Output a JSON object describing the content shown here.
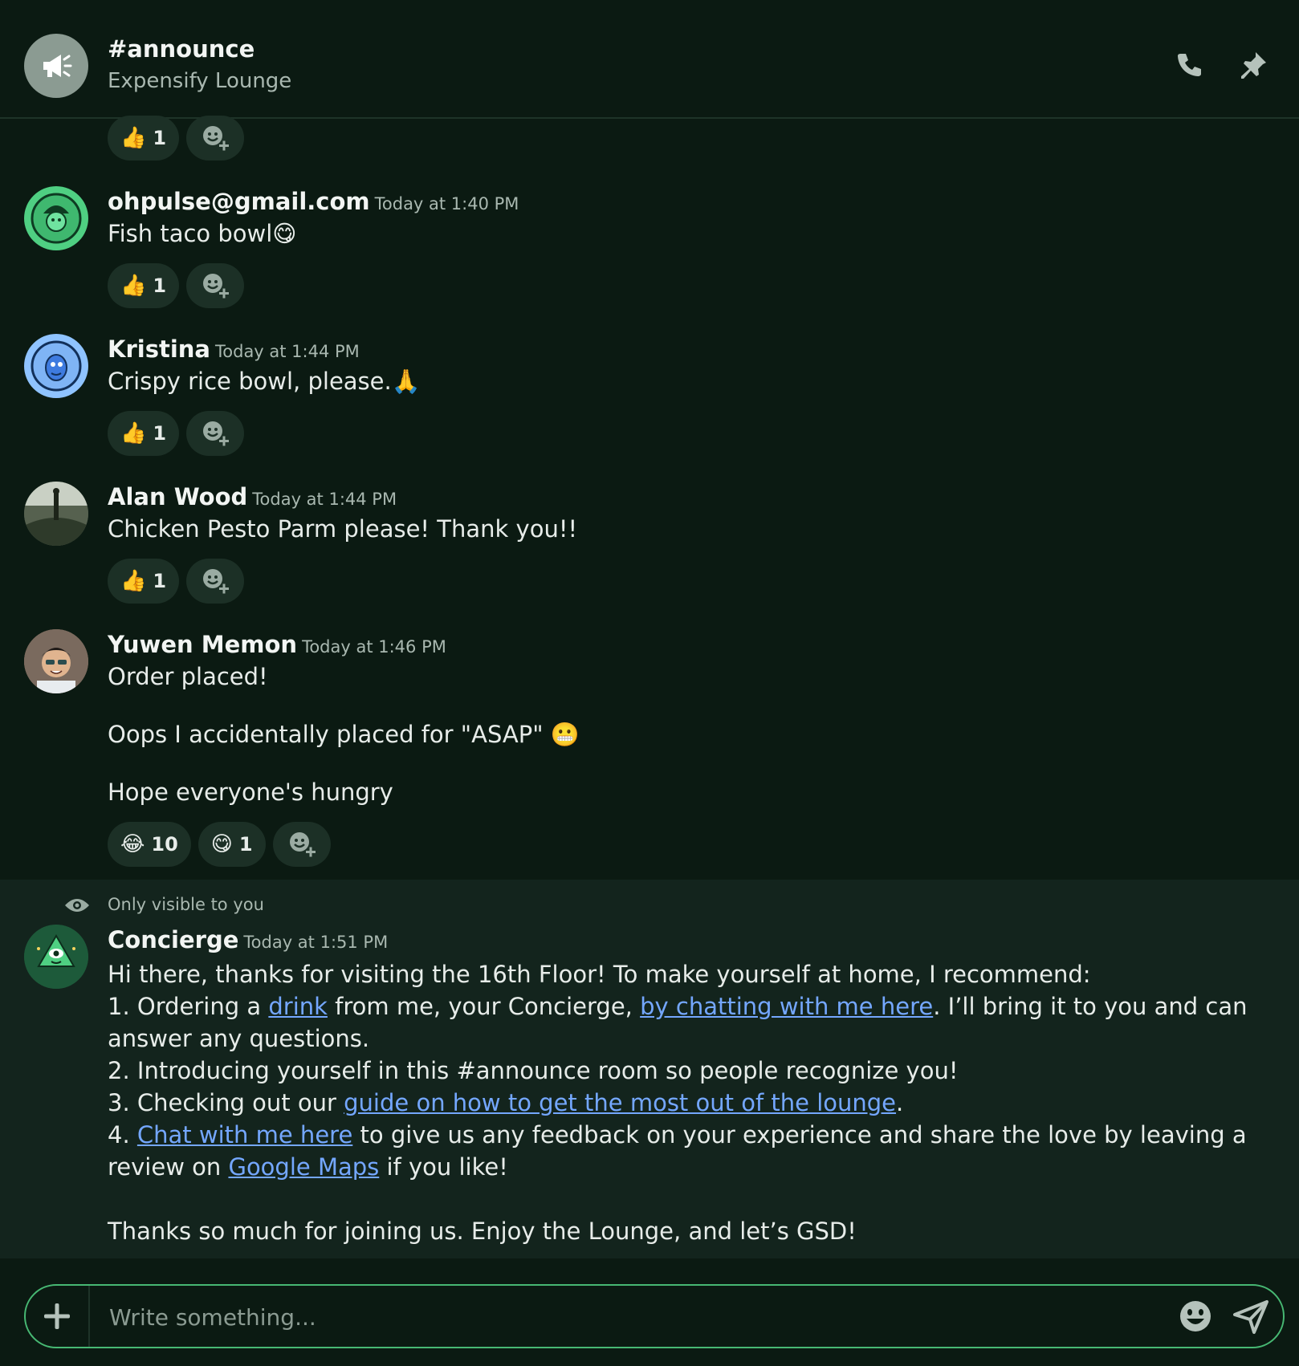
{
  "header": {
    "channel": "#announce",
    "workspace": "Expensify Lounge",
    "channel_icon": "megaphone-icon",
    "actions": [
      "phone-icon",
      "pin-icon"
    ]
  },
  "top_reactions": {
    "thumbs_count": "1"
  },
  "messages": [
    {
      "author": "ohpulse@gmail.com",
      "time": "Today at 1:40 PM",
      "lines": [
        "Fish taco bowl😋"
      ],
      "reactions": [
        {
          "emoji": "👍",
          "count": "1"
        }
      ]
    },
    {
      "author": "Kristina",
      "time": "Today at 1:44 PM",
      "lines": [
        "Crispy rice bowl, please.🙏"
      ],
      "reactions": [
        {
          "emoji": "👍",
          "count": "1"
        }
      ]
    },
    {
      "author": "Alan Wood",
      "time": "Today at 1:44 PM",
      "lines": [
        "Chicken Pesto Parm please! Thank you!!"
      ],
      "reactions": [
        {
          "emoji": "👍",
          "count": "1"
        }
      ]
    },
    {
      "author": "Yuwen Memon",
      "time": "Today at 1:46 PM",
      "lines": [
        "Order placed!",
        "Oops I accidentally placed for \"ASAP\" 😬",
        "Hope everyone's hungry"
      ],
      "reactions": [
        {
          "emoji": "😂",
          "count": "10"
        },
        {
          "emoji": "😋",
          "count": "1"
        }
      ]
    }
  ],
  "concierge": {
    "visibility_note": "Only visible to you",
    "author": "Concierge",
    "time": "Today at 1:51 PM",
    "intro": "Hi there, thanks for visiting the 16th Floor! To make yourself at home, I recommend:",
    "item1_pre": "1. Ordering a ",
    "item1_link1": "drink",
    "item1_mid": " from me, your Concierge, ",
    "item1_link2": "by chatting with me here",
    "item1_post": ". I’ll bring it to you and can answer any questions.",
    "item2": "2. Introducing yourself in this #announce room so people recognize you!",
    "item3_pre": "3. Checking out our ",
    "item3_link": "guide on how to get the most out of the lounge",
    "item3_post": ".",
    "item4_pre": "4. ",
    "item4_link1": "Chat with me here",
    "item4_mid": " to give us any feedback on your experience and share the love by leaving a review on ",
    "item4_link2": "Google Maps",
    "item4_post": " if you like!",
    "closing": "Thanks so much for joining us. Enjoy the Lounge, and let’s GSD!"
  },
  "composer": {
    "placeholder": "Write something...",
    "value": ""
  },
  "colors": {
    "background": "#0b1a12",
    "panel": "#13241d",
    "reaction": "#1c3026",
    "accent": "#47b873",
    "link": "#74a7ff"
  }
}
